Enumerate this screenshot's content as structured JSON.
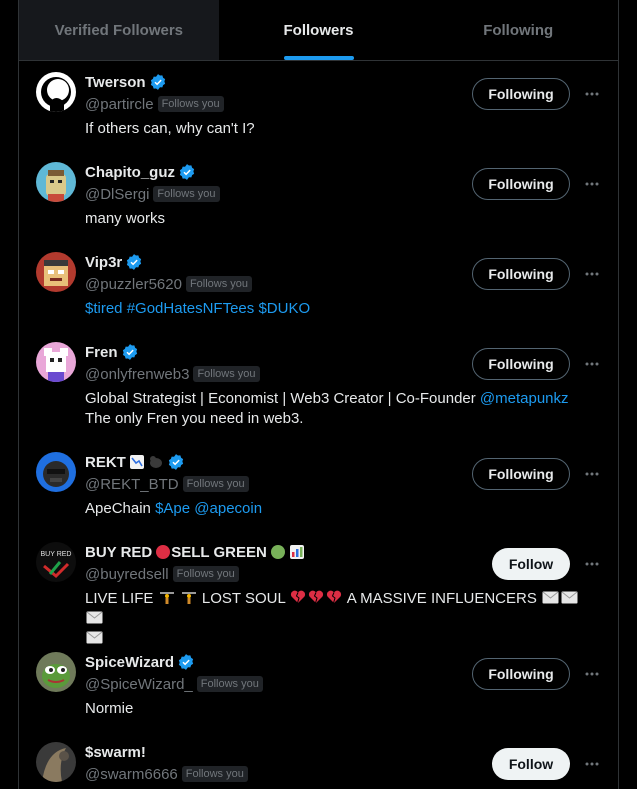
{
  "tabs": [
    {
      "label": "Verified Followers"
    },
    {
      "label": "Followers"
    },
    {
      "label": "Following"
    }
  ],
  "follows_you_label": "Follows you",
  "users": [
    {
      "name": "Twerson",
      "handle": "@partircle",
      "button": "Following",
      "bio": "If others can, why can't I?"
    },
    {
      "name": "Chapito_guz",
      "handle": "@DlSergi",
      "button": "Following",
      "bio": "many works"
    },
    {
      "name": "Vip3r",
      "handle": "@puzzler5620",
      "button": "Following",
      "bio_links": [
        "$tired",
        "#GodHatesNFTees",
        "$DUKO"
      ]
    },
    {
      "name": "Fren",
      "handle": "@onlyfrenweb3",
      "button": "Following",
      "bio": "Global Strategist | Economist | Web3 Creator | Co-Founder",
      "bio_link": "@metapunkz",
      "bio_line2": "The only Fren you need in web3."
    },
    {
      "name": "REKT",
      "handle": "@REKT_BTD",
      "button": "Following",
      "bio": "ApeChain",
      "bio_links": [
        "$Ape",
        "@apecoin"
      ]
    },
    {
      "name": "BUY RED",
      "name_mid": "SELL GREEN",
      "handle": "@buyredsell",
      "button": "Follow",
      "bio_part1": "LIVE LIFE",
      "bio_part2": "LOST SOUL",
      "bio_part3": "A MASSIVE INFLUENCERS"
    },
    {
      "name": "SpiceWizard",
      "handle": "@SpiceWizard_",
      "button": "Following",
      "bio": "Normie"
    },
    {
      "name": "$swarm!",
      "handle": "@swarm6666",
      "button": "Follow"
    }
  ],
  "colors": {
    "accent": "#1d9bf0",
    "bg": "#000000",
    "secondary_text": "#71767b",
    "border": "#2f3336"
  }
}
